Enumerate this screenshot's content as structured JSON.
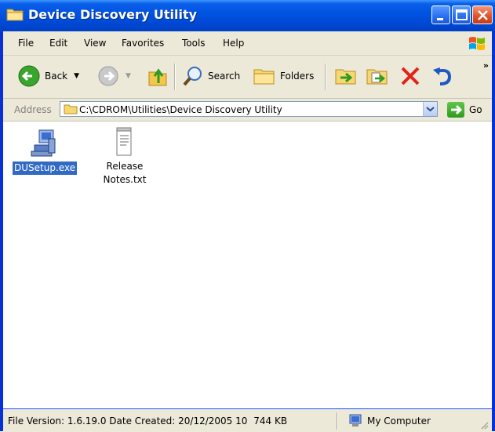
{
  "window": {
    "title": "Device Discovery Utility",
    "controls": [
      "minimize",
      "maximize",
      "close"
    ]
  },
  "menu": {
    "items": [
      "File",
      "Edit",
      "View",
      "Favorites",
      "Tools",
      "Help"
    ]
  },
  "toolbar": {
    "back_label": "Back",
    "search_label": "Search",
    "folders_label": "Folders",
    "overflow": "»"
  },
  "address": {
    "label": "Address",
    "value": "C:\\CDROM\\Utilities\\Device Discovery Utility",
    "go_label": "Go"
  },
  "files": [
    {
      "name": "DUSetup.exe",
      "icon": "installer-icon",
      "selected": true
    },
    {
      "name_line1": "Release",
      "name_line2": "Notes.txt",
      "icon": "text-file-icon",
      "selected": false
    }
  ],
  "status": {
    "info": "File Version: 1.6.19.0 Date Created: 20/12/2005 10",
    "size": "744 KB",
    "zone": "My Computer"
  },
  "colors": {
    "titlebar": "#0054e3",
    "selection": "#316ac5",
    "chrome": "#ece9d8"
  }
}
